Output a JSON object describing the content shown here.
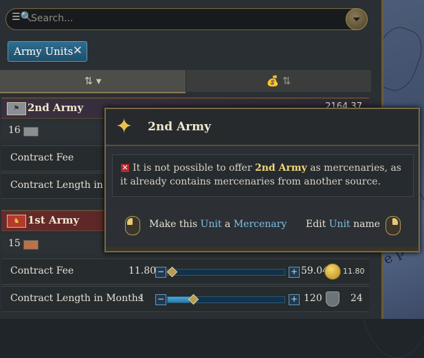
{
  "search": {
    "placeholder": "Search..."
  },
  "filter_tag": {
    "label": "Army Units",
    "close": "✕"
  },
  "sort": {
    "left": "⇅ ▾",
    "right": "💰 ⇅"
  },
  "armies": [
    {
      "name": "2nd Army",
      "gold": "2164.37",
      "count": "16",
      "rows": [
        {
          "label": "Contract Fee"
        },
        {
          "label": "Contract Length in Months"
        }
      ]
    },
    {
      "name": "1st Army",
      "count": "15",
      "rows": [
        {
          "label": "Contract Fee",
          "min": "11.80",
          "max": "59.04",
          "cost": "11.80",
          "level": 0.0
        },
        {
          "label": "Contract Length in Months",
          "min": "1",
          "max": "120",
          "months": "24",
          "level": 0.19
        }
      ]
    }
  ],
  "tooltip": {
    "title": "2nd Army",
    "message_before": "It is not possible to offer ",
    "message_highlight": "2nd Army",
    "message_after": " as mercenaries, as it already contains mercenaries from another source.",
    "action_left_1": "Make this ",
    "action_left_unit": "Unit",
    "action_left_2": " a ",
    "action_left_merc": "Mercenary",
    "action_right_1": "Edit ",
    "action_right_unit": "Unit",
    "action_right_2": " name"
  },
  "icons": {
    "search": "search-icon",
    "filter": "filter-icon",
    "star": "star-icon",
    "error": "x-icon",
    "mouse": "mouse-icon",
    "coin": "coin-icon"
  }
}
